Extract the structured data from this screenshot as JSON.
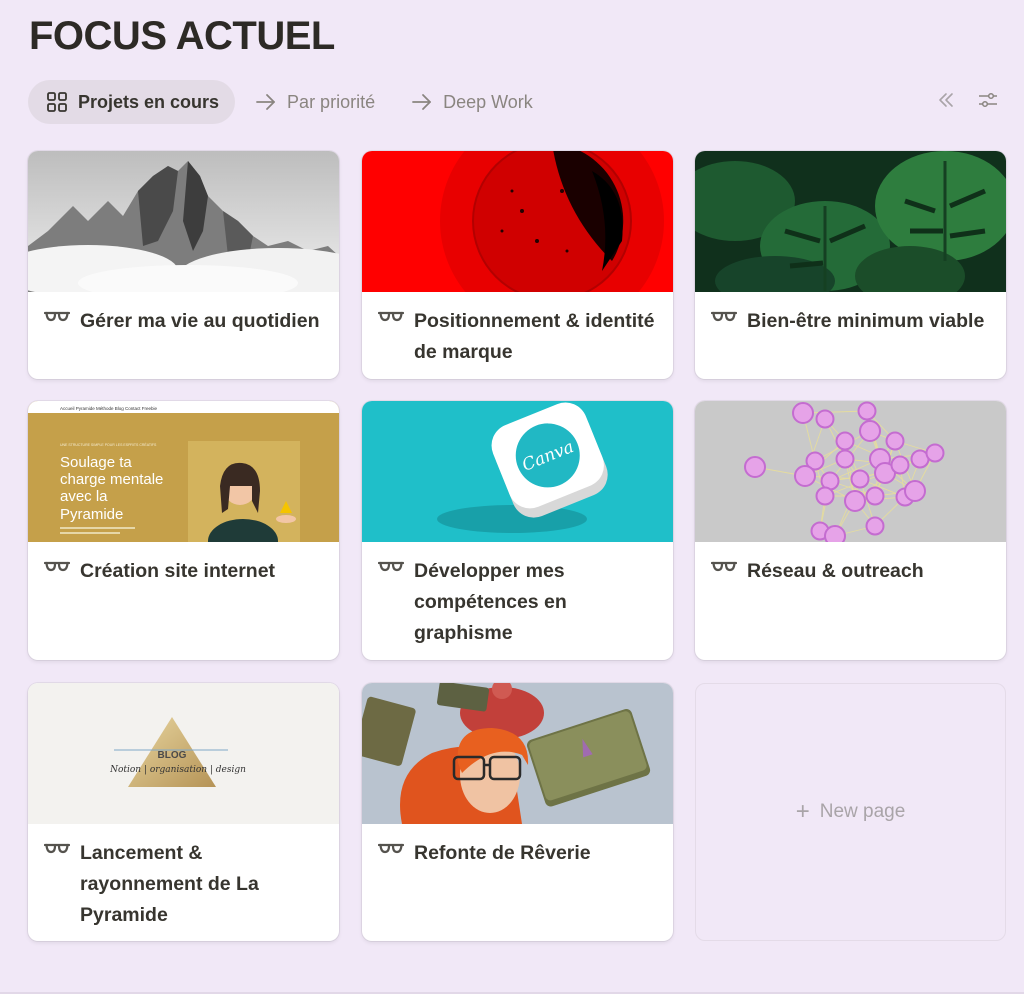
{
  "page": {
    "title": "FOCUS ACTUEL"
  },
  "views": [
    {
      "label": "Projets en cours",
      "icon": "gallery-icon",
      "active": true
    },
    {
      "label": "Par priorité",
      "icon": "arrow-right-icon",
      "active": false
    },
    {
      "label": "Deep Work",
      "icon": "arrow-right-icon",
      "active": false
    }
  ],
  "tools": [
    {
      "icon": "collapse-double-chevron-icon"
    },
    {
      "icon": "filter-settings-icon"
    }
  ],
  "cards": [
    {
      "title": "Gérer ma vie au quotidien",
      "cover": "misty-mountain-peak",
      "icon": "glasses-icon"
    },
    {
      "title": "Positionnement & identité de marque",
      "cover": "red-textured-circle",
      "icon": "glasses-icon"
    },
    {
      "title": "Bien-être minimum viable",
      "cover": "monstera-leaves",
      "icon": "glasses-icon"
    },
    {
      "title": "Création site internet",
      "cover": "website-mockup",
      "icon": "glasses-icon",
      "cover_text": {
        "nav": "Accueil   Pyramide   Méthode   Blog   Contact   Freebie",
        "kicker": "UNE STRUCTURE SIMPLE POUR LES ESPRITS CRÉATIFS",
        "headline": "Soulage ta charge mentale avec la Pyramide"
      }
    },
    {
      "title": "Développer mes compétences en graphisme",
      "cover": "canva-app-icon",
      "icon": "glasses-icon",
      "cover_text": {
        "logo": "Canva"
      }
    },
    {
      "title": "Réseau & outreach",
      "cover": "network-graph",
      "icon": "glasses-icon"
    },
    {
      "title": " Lancement & rayonnement de La Pyramide",
      "cover": "blog-pyramid-logo",
      "icon": "glasses-icon",
      "cover_text": {
        "logo": "BLOG",
        "tagline": "Notion | organisation | design"
      }
    },
    {
      "title": "Refonte de Rêverie",
      "cover": "redhead-floating-books",
      "icon": "glasses-icon"
    }
  ],
  "new_page": {
    "label": "New page",
    "icon": "plus-icon"
  }
}
